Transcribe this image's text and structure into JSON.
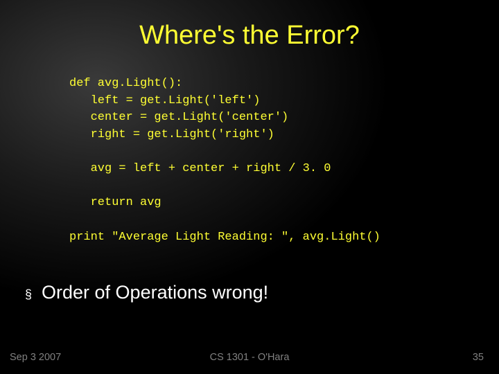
{
  "title": "Where's the Error?",
  "code": {
    "l1": "def avg.Light():",
    "l2": "   left = get.Light('left')",
    "l3": "   center = get.Light('center')",
    "l4": "   right = get.Light('right')",
    "l5": "",
    "l6": "   avg = left + center + right / 3. 0",
    "l7": "",
    "l8": "   return avg",
    "l9": "",
    "l10": "print \"Average Light Reading: \", avg.Light()"
  },
  "bullet": {
    "marker": "§",
    "text": "Order of Operations wrong!"
  },
  "footer": {
    "left": "Sep 3 2007",
    "center": "CS 1301 - O'Hara",
    "right": "35"
  }
}
